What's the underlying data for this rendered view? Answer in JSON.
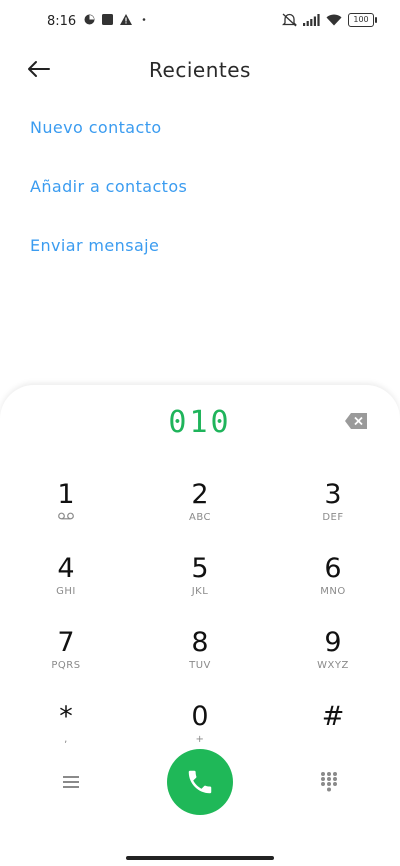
{
  "status_bar": {
    "time": "8:16",
    "battery": "100",
    "icons": [
      "alarm-icon",
      "square-icon",
      "warning-icon",
      "dot-icon",
      "mute-icon",
      "signal-icon",
      "wifi-icon",
      "battery-icon"
    ]
  },
  "header": {
    "title": "Recientes",
    "back_icon": "back-arrow-icon"
  },
  "actions": [
    {
      "label": "Nuevo contacto"
    },
    {
      "label": "Añadir a contactos"
    },
    {
      "label": "Enviar mensaje"
    }
  ],
  "dialpad": {
    "number": "010",
    "keys": [
      {
        "digit": "1",
        "letters": "voicemail-icon"
      },
      {
        "digit": "2",
        "letters": "ABC"
      },
      {
        "digit": "3",
        "letters": "DEF"
      },
      {
        "digit": "4",
        "letters": "GHI"
      },
      {
        "digit": "5",
        "letters": "JKL"
      },
      {
        "digit": "6",
        "letters": "MNO"
      },
      {
        "digit": "7",
        "letters": "PQRS"
      },
      {
        "digit": "8",
        "letters": "TUV"
      },
      {
        "digit": "9",
        "letters": "WXYZ"
      },
      {
        "digit": "*",
        "letters": ","
      },
      {
        "digit": "0",
        "letters": "+"
      },
      {
        "digit": "#",
        "letters": ""
      }
    ]
  },
  "colors": {
    "accent_link": "#3b9cf0",
    "number": "#1fb45b",
    "call_button": "#1fb858"
  }
}
